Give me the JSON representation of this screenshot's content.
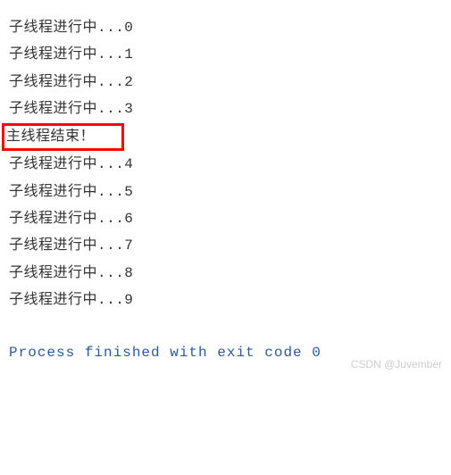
{
  "lines": [
    {
      "text": "子线程进行中...0",
      "highlighted": false
    },
    {
      "text": "子线程进行中...1",
      "highlighted": false
    },
    {
      "text": "子线程进行中...2",
      "highlighted": false
    },
    {
      "text": "子线程进行中...3",
      "highlighted": false
    },
    {
      "text": "主线程结束！",
      "highlighted": true
    },
    {
      "text": "子线程进行中...4",
      "highlighted": false
    },
    {
      "text": "子线程进行中...5",
      "highlighted": false
    },
    {
      "text": "子线程进行中...6",
      "highlighted": false
    },
    {
      "text": "子线程进行中...7",
      "highlighted": false
    },
    {
      "text": "子线程进行中...8",
      "highlighted": false
    },
    {
      "text": "子线程进行中...9",
      "highlighted": false
    }
  ],
  "finalLine": "Process finished with exit code 0",
  "watermark": "CSDN @Juvember"
}
